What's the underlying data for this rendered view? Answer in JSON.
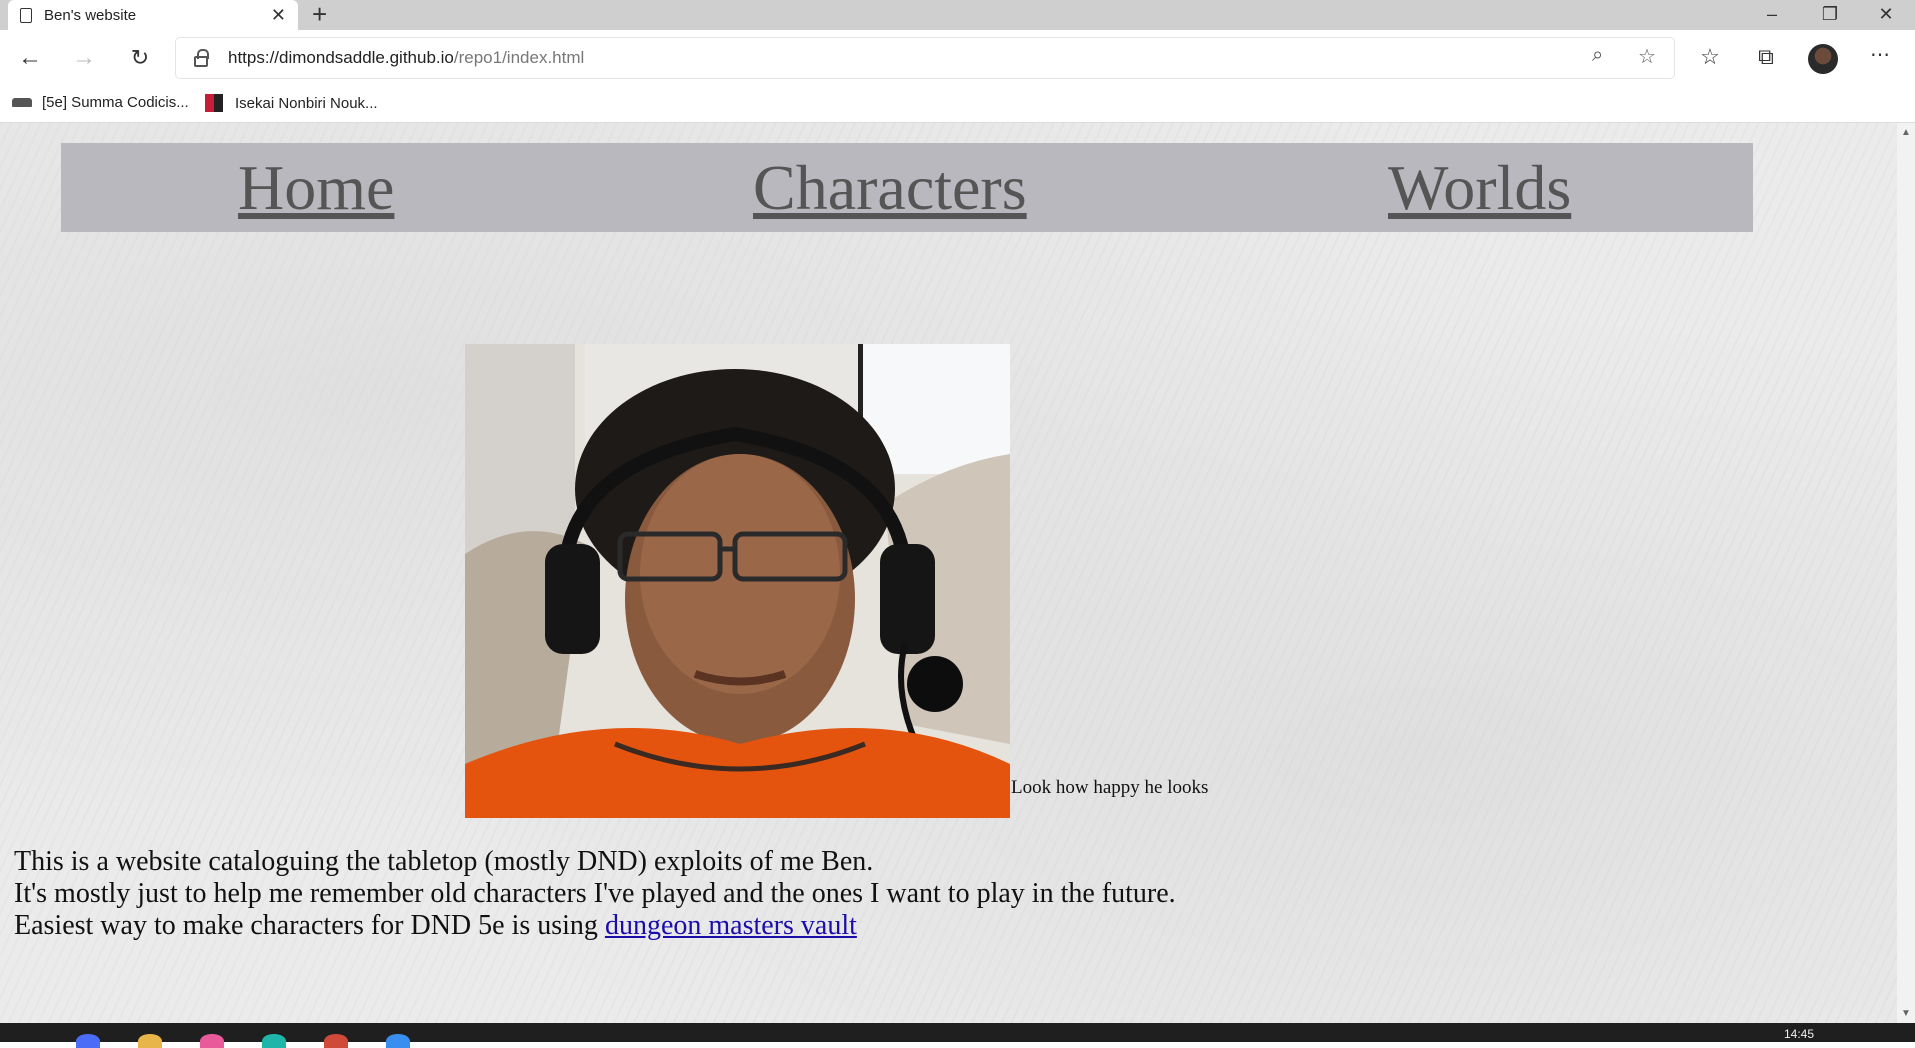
{
  "browser": {
    "tab_title": "Ben's website",
    "tab_close": "✕",
    "new_tab": "+",
    "url_domain": "https://dimondsaddle.github.io",
    "url_path": "/repo1/index.html",
    "bookmarks": [
      "[5e] Summa Codicis...",
      "Isekai Nonbiri Nouk..."
    ],
    "window_controls": [
      "–",
      "❐",
      "✕"
    ],
    "nav_icons": [
      "back-icon",
      "forward-icon",
      "refresh-icon"
    ],
    "toolbar_icons": [
      "zoom-icon",
      "add-favorite-icon",
      "favorites-icon",
      "collections-icon",
      "profile-avatar",
      "more-icon"
    ]
  },
  "page": {
    "menu": [
      "Home",
      "Characters",
      "Worlds"
    ],
    "caption": "Look how happy he looks",
    "intro": {
      "line1": "This is a website cataloguing the tabletop (mostly DND) exploits of me Ben.",
      "line2": "It's mostly just to help me remember old characters I've played and the ones I want to play in the future.",
      "line3_prefix": "Easiest way to make characters for DND 5e is using ",
      "link": "dungeon masters vault"
    }
  },
  "taskbar": {
    "clock": "14:45"
  },
  "colors": {
    "menu_bg": "#b9b8bf",
    "menu_text": "#555555",
    "link": "#1a0dab",
    "page_bg": "#ebebeb"
  }
}
